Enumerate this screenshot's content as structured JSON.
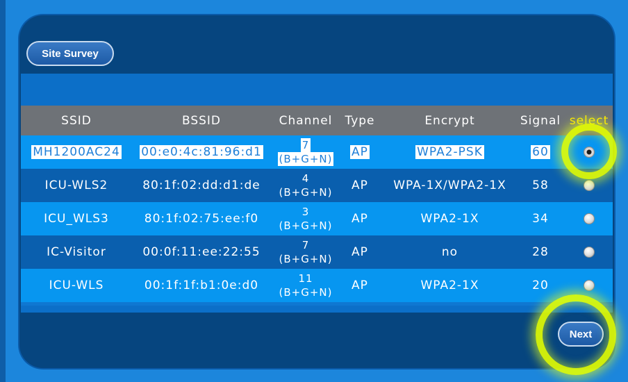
{
  "survey_button": "Site Survey",
  "next_button": "Next",
  "columns": [
    "SSID",
    "BSSID",
    "Channel",
    "Type",
    "Encrypt",
    "Signal",
    "select"
  ],
  "rows": [
    {
      "ssid": "MH1200AC24",
      "bssid": "00:e0:4c:81:96:d1",
      "channel": "7",
      "mode": "(B+G+N)",
      "type": "AP",
      "encrypt": "WPA2-PSK",
      "signal": "60",
      "selected": true
    },
    {
      "ssid": "ICU-WLS2",
      "bssid": "80:1f:02:dd:d1:de",
      "channel": "4",
      "mode": "(B+G+N)",
      "type": "AP",
      "encrypt": "WPA-1X/WPA2-1X",
      "signal": "58",
      "selected": false
    },
    {
      "ssid": "ICU_WLS3",
      "bssid": "80:1f:02:75:ee:f0",
      "channel": "3",
      "mode": "(B+G+N)",
      "type": "AP",
      "encrypt": "WPA2-1X",
      "signal": "34",
      "selected": false
    },
    {
      "ssid": "IC-Visitor",
      "bssid": "00:0f:11:ee:22:55",
      "channel": "7",
      "mode": "(B+G+N)",
      "type": "AP",
      "encrypt": "no",
      "signal": "28",
      "selected": false
    },
    {
      "ssid": "ICU-WLS",
      "bssid": "00:1f:1f:b1:0e:d0",
      "channel": "11",
      "mode": "(B+G+N)",
      "type": "AP",
      "encrypt": "WPA2-1X",
      "signal": "20",
      "selected": false
    }
  ],
  "colors": {
    "panel": "#06457f",
    "header": "#6e7277",
    "row_light": "#0796f0",
    "row_dark": "#0a5fae",
    "select_header": "#ffe800",
    "highlight_ring": "#e6ff00"
  }
}
